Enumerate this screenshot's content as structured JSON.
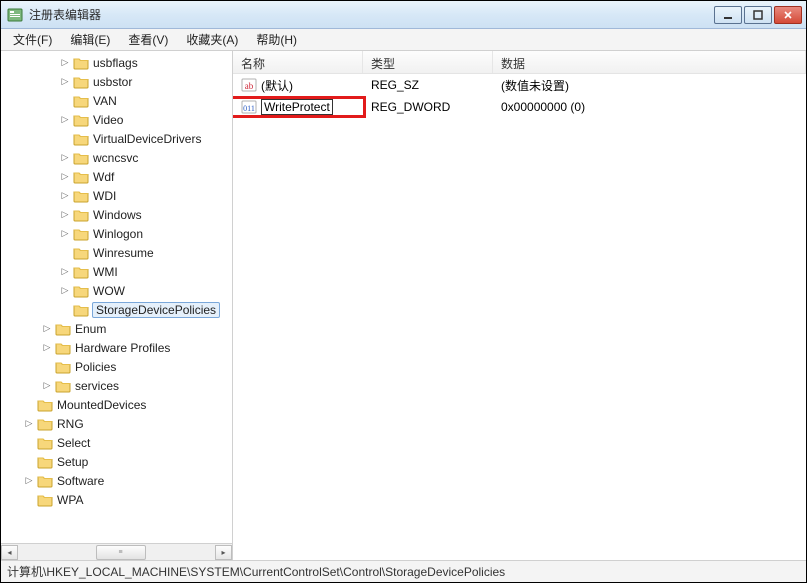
{
  "window": {
    "title": "注册表编辑器"
  },
  "menu": {
    "file": "文件(F)",
    "edit": "编辑(E)",
    "view": "查看(V)",
    "favorites": "收藏夹(A)",
    "help": "帮助(H)"
  },
  "tree": {
    "items": [
      {
        "indent": 3,
        "exp": "▷",
        "label": "usbflags"
      },
      {
        "indent": 3,
        "exp": "▷",
        "label": "usbstor"
      },
      {
        "indent": 3,
        "exp": "",
        "label": "VAN"
      },
      {
        "indent": 3,
        "exp": "▷",
        "label": "Video"
      },
      {
        "indent": 3,
        "exp": "",
        "label": "VirtualDeviceDrivers"
      },
      {
        "indent": 3,
        "exp": "▷",
        "label": "wcncsvc"
      },
      {
        "indent": 3,
        "exp": "▷",
        "label": "Wdf"
      },
      {
        "indent": 3,
        "exp": "▷",
        "label": "WDI"
      },
      {
        "indent": 3,
        "exp": "▷",
        "label": "Windows"
      },
      {
        "indent": 3,
        "exp": "▷",
        "label": "Winlogon"
      },
      {
        "indent": 3,
        "exp": "",
        "label": "Winresume"
      },
      {
        "indent": 3,
        "exp": "▷",
        "label": "WMI"
      },
      {
        "indent": 3,
        "exp": "▷",
        "label": "WOW"
      },
      {
        "indent": 3,
        "exp": "",
        "label": "StorageDevicePolicies",
        "selected": true
      },
      {
        "indent": 2,
        "exp": "▷",
        "label": "Enum"
      },
      {
        "indent": 2,
        "exp": "▷",
        "label": "Hardware Profiles"
      },
      {
        "indent": 2,
        "exp": "",
        "label": "Policies"
      },
      {
        "indent": 2,
        "exp": "▷",
        "label": "services"
      },
      {
        "indent": 1,
        "exp": "",
        "label": "MountedDevices"
      },
      {
        "indent": 1,
        "exp": "▷",
        "label": "RNG"
      },
      {
        "indent": 1,
        "exp": "",
        "label": "Select"
      },
      {
        "indent": 1,
        "exp": "",
        "label": "Setup"
      },
      {
        "indent": 1,
        "exp": "▷",
        "label": "Software"
      },
      {
        "indent": 1,
        "exp": "",
        "label": "WPA"
      }
    ]
  },
  "list": {
    "columns": {
      "name": "名称",
      "type": "类型",
      "data": "数据"
    },
    "rows": [
      {
        "icon": "string-value-icon",
        "name": "(默认)",
        "type": "REG_SZ",
        "data": "(数值未设置)",
        "editing": false,
        "highlighted": false
      },
      {
        "icon": "binary-value-icon",
        "name": "WriteProtect",
        "type": "REG_DWORD",
        "data": "0x00000000 (0)",
        "editing": true,
        "highlighted": true
      }
    ]
  },
  "status": {
    "path": "计算机\\HKEY_LOCAL_MACHINE\\SYSTEM\\CurrentControlSet\\Control\\StorageDevicePolicies"
  }
}
